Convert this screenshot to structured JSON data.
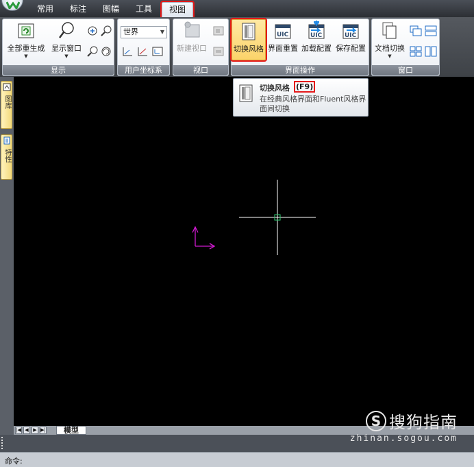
{
  "tabs": [
    {
      "label": "常用"
    },
    {
      "label": "标注"
    },
    {
      "label": "图幅"
    },
    {
      "label": "工具"
    },
    {
      "label": "视图",
      "active": true
    }
  ],
  "ribbon": {
    "display_panel": {
      "title": "显示",
      "regen_all_label": "全部重生成",
      "display_window_label": "显示窗口"
    },
    "ucs_panel": {
      "title": "用户坐标系",
      "combo_value": "世界"
    },
    "viewport_panel": {
      "title": "视口",
      "new_viewport_label": "新建视口"
    },
    "interface_panel": {
      "title": "界面操作",
      "switch_style_label": "切换风格",
      "reset_ui_label": "界面重置",
      "load_config_label": "加载配置",
      "save_config_label": "保存配置"
    },
    "window_panel": {
      "title": "窗口",
      "doc_switch_label": "文档切换"
    }
  },
  "tooltip": {
    "title": "切换风格",
    "shortcut": "(F9)",
    "description": "在经典风格界面和Fluent风格界面间切换"
  },
  "left_palette": {
    "tab1_label": "图库",
    "tab2_label": "特性"
  },
  "layout_tabs": {
    "model_tab": "模型"
  },
  "command": {
    "prompt": "命令:"
  },
  "watermark": {
    "symbol": "S",
    "name": "搜狗指南",
    "url": "zhinan.sogou.com"
  },
  "colors": {
    "highlight_outline": "#e41919",
    "crosshair": "#ffffff",
    "pickbox": "#2ecc71",
    "ucs_icon": "#d01ad0",
    "canvas_bg": "#000000"
  }
}
